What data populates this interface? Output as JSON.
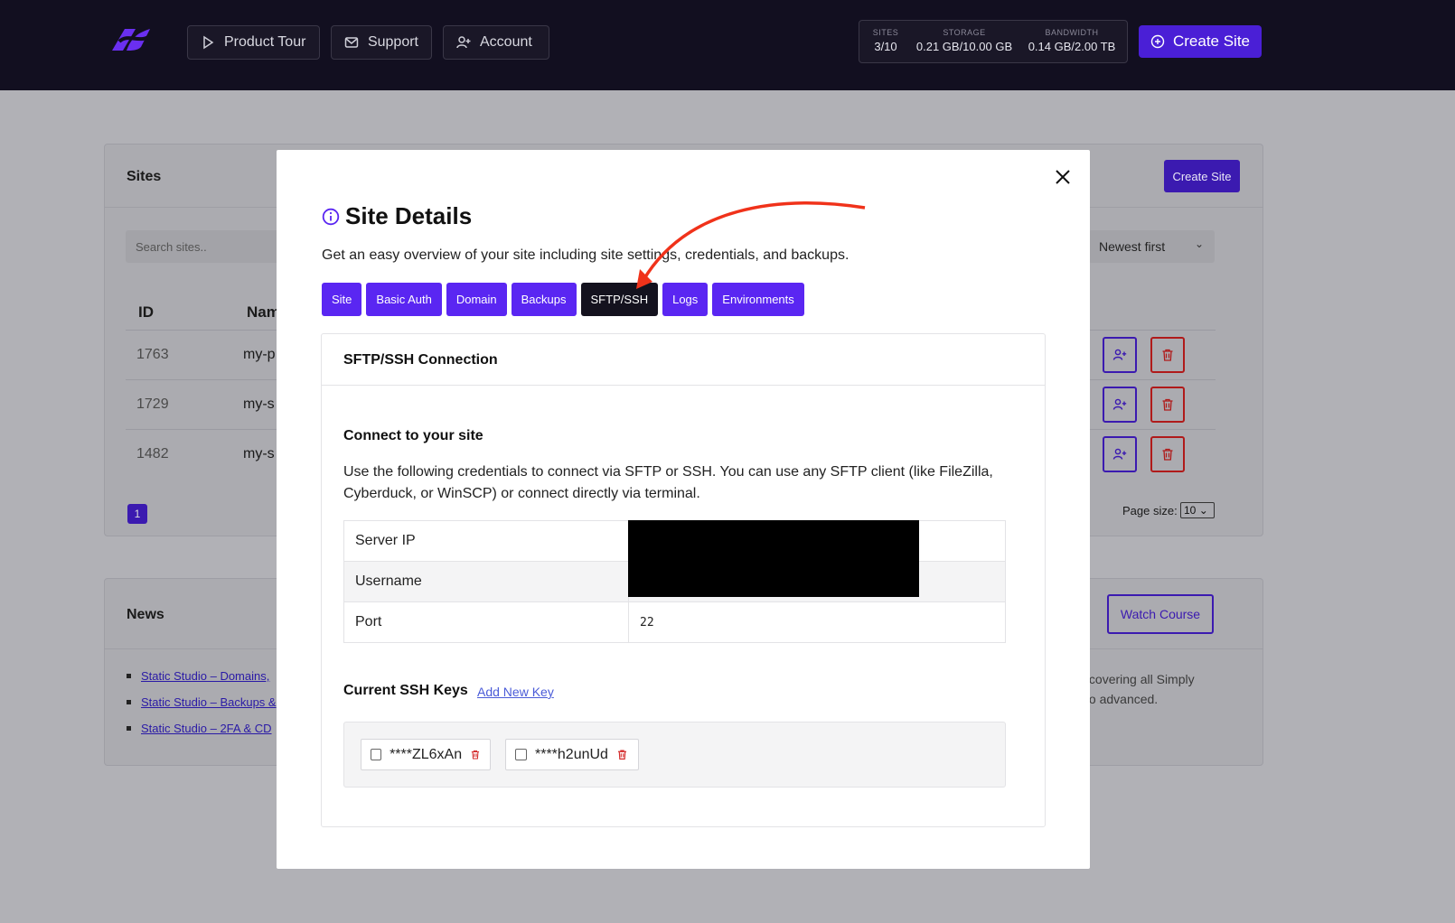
{
  "topbar": {
    "nav": [
      {
        "label": "Product Tour",
        "icon": "play-icon"
      },
      {
        "label": "Support",
        "icon": "mail-icon"
      },
      {
        "label": "Account",
        "icon": "user-plus-icon"
      }
    ],
    "stats": [
      {
        "label": "SITES",
        "value": "3/10"
      },
      {
        "label": "STORAGE",
        "value": "0.21 GB/10.00 GB"
      },
      {
        "label": "BANDWIDTH",
        "value": "0.14 GB/2.00 TB"
      }
    ],
    "create_label": "Create Site"
  },
  "sites": {
    "title": "Sites",
    "create_label": "Create Site",
    "search_placeholder": "Search sites..",
    "sort_value": "Newest first",
    "columns": [
      "ID",
      "Nam"
    ],
    "rows": [
      {
        "id": "1763",
        "name": "my-p"
      },
      {
        "id": "1729",
        "name": "my-s"
      },
      {
        "id": "1482",
        "name": "my-s"
      }
    ],
    "page": "1",
    "page_size_label": "Page size:",
    "page_size_value": "10"
  },
  "news": {
    "title": "News",
    "watch_label": "Watch Course",
    "items": [
      "Static Studio – Domains,",
      "Static Studio – Backups &",
      "Static Studio – 2FA & CD"
    ],
    "text_line1": "ourse covering all Simply",
    "text_line2": "inner to advanced."
  },
  "modal": {
    "title": "Site Details",
    "description": "Get an easy overview of your site including site settings, credentials, and backups.",
    "tabs": [
      "Site",
      "Basic Auth",
      "Domain",
      "Backups",
      "SFTP/SSH",
      "Logs",
      "Environments"
    ],
    "active_tab": "SFTP/SSH",
    "panel_title": "SFTP/SSH Connection",
    "connect_heading": "Connect to your site",
    "connect_text": "Use the following credentials to connect via SFTP or SSH. You can use any SFTP client (like FileZilla, Cyberduck, or WinSCP) or connect directly via terminal.",
    "credentials": [
      {
        "key": "Server IP",
        "value": ""
      },
      {
        "key": "Username",
        "value": ""
      },
      {
        "key": "Port",
        "value": "22"
      }
    ],
    "keys_heading": "Current SSH Keys",
    "add_key_label": "Add New Key",
    "ssh_keys": [
      "****ZL6xAn",
      "****h2unUd"
    ]
  },
  "colors": {
    "accent": "#5a26f2",
    "topbar": "#120f20",
    "annotation_arrow": "#f0321a"
  }
}
